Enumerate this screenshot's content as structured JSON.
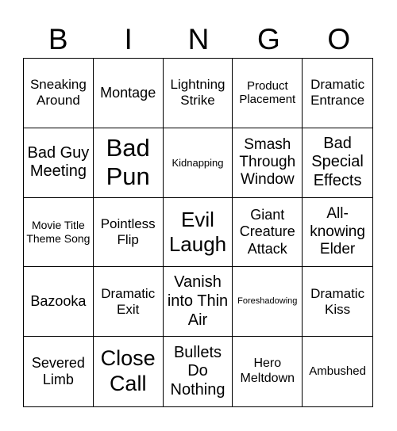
{
  "header": [
    "B",
    "I",
    "N",
    "G",
    "O"
  ],
  "cells": [
    "Sneaking Around",
    "Montage",
    "Lightning Strike",
    "Product Placement",
    "Dramatic Entrance",
    "Bad Guy Meeting",
    "Bad Pun",
    "Kidnapping",
    "Smash Through Window",
    "Bad Special Effects",
    "Movie Title Theme Song",
    "Pointless Flip",
    "Evil Laugh",
    "Giant Creature Attack",
    "All-knowing Elder",
    "Bazooka",
    "Dramatic Exit",
    "Vanish into Thin Air",
    "Foreshadowing",
    "Dramatic Kiss",
    "Severed Limb",
    "Close Call",
    "Bullets Do Nothing",
    "Hero Meltdown",
    "Ambushed"
  ]
}
